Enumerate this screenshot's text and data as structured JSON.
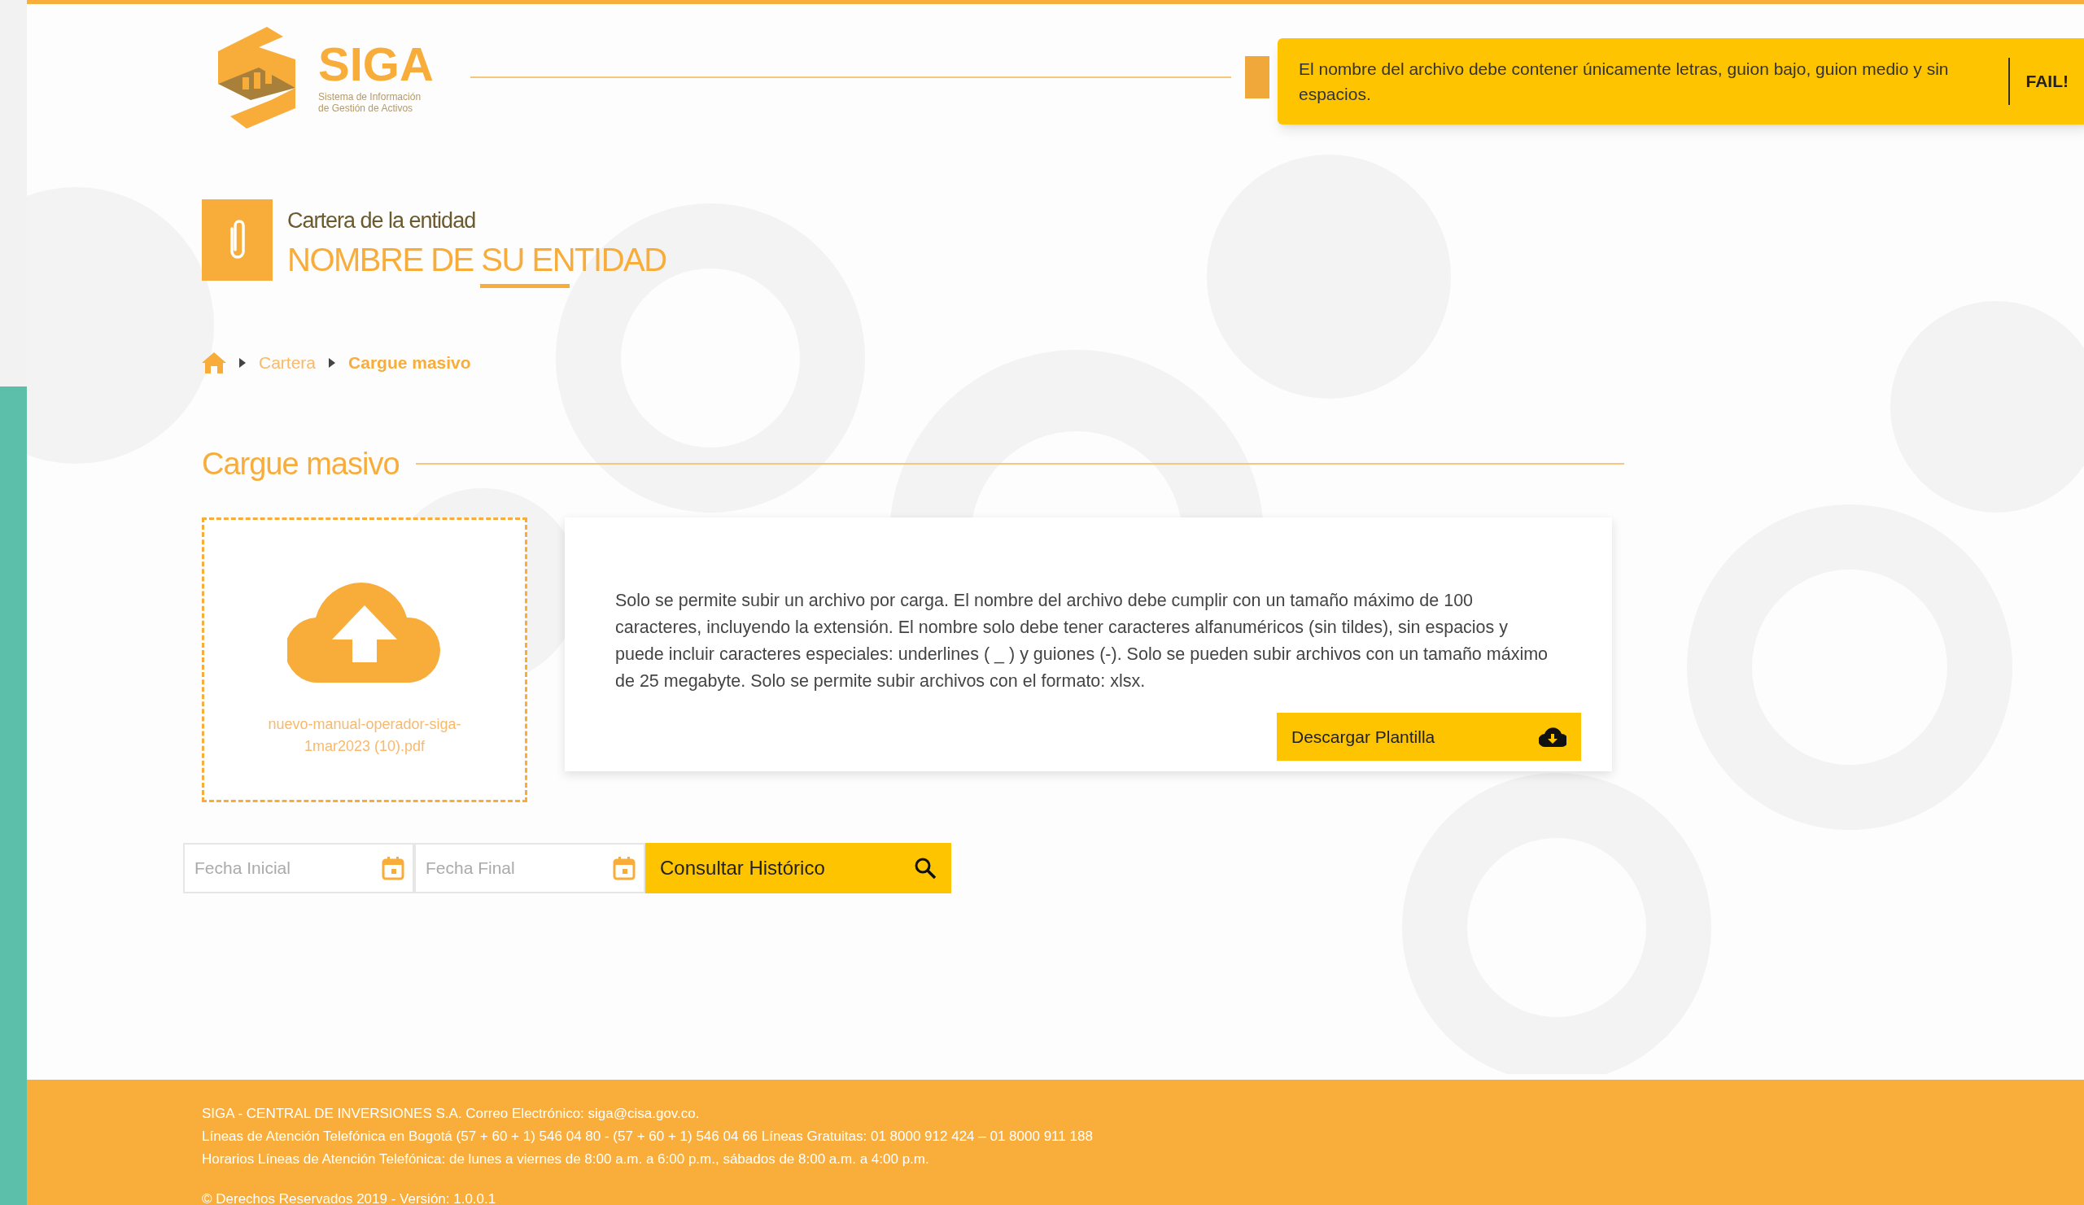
{
  "logo": {
    "title": "SIGA",
    "subtitle_lines": [
      "Sistema de Información",
      "de Gestión de Activos"
    ]
  },
  "toast": {
    "message": "El nombre del archivo debe contener únicamente letras, guion bajo, guion medio y sin espacios.",
    "action": "FAIL!"
  },
  "page_header": {
    "overline": "Cartera de la entidad",
    "title": "NOMBRE DE SU ENTIDAD"
  },
  "breadcrumb": [
    {
      "label": "Cartera",
      "selected": false
    },
    {
      "label": "Cargue masivo",
      "selected": true
    }
  ],
  "section_title": "Cargue masivo",
  "upload": {
    "file_name": "nuevo-manual-operador-siga-1mar2023 (10).pdf"
  },
  "info": {
    "text": "Solo se permite subir un archivo por carga. El nombre del archivo debe cumplir con un tamaño máximo de 100 caracteres, incluyendo la extensión. El nombre solo debe tener caracteres alfanuméricos (sin tildes), sin espacios y puede incluir caracteres especiales: underlines ( _ ) y guiones (-). Solo se pueden subir archivos con un tamaño máximo de 25 megabyte. Solo se permite subir archivos con el formato: xlsx.",
    "button": "Descargar Plantilla"
  },
  "filters": {
    "fields": [
      {
        "placeholder": "Fecha Inicial"
      },
      {
        "placeholder": "Fecha Final"
      }
    ],
    "button": "Consultar Histórico"
  },
  "footer": {
    "lines": [
      "SIGA - CENTRAL DE INVERSIONES S.A. Correo Electrónico: siga@cisa.gov.co.",
      "Líneas de Atención Telefónica en Bogotá (57 + 60 + 1) 546 04 80 - (57 + 60 + 1) 546 04 66 Líneas Gratuitas: 01 8000 912 424 – 01 8000 911 188",
      "Horarios Líneas de Atención Telefónica: de lunes a viernes de 8:00 a.m. a 6:00 p.m., sábados de 8:00 a.m. a 4:00 p.m."
    ],
    "copyright": "© Derechos Reservados 2019 - Versión: 1.0.0.1"
  }
}
